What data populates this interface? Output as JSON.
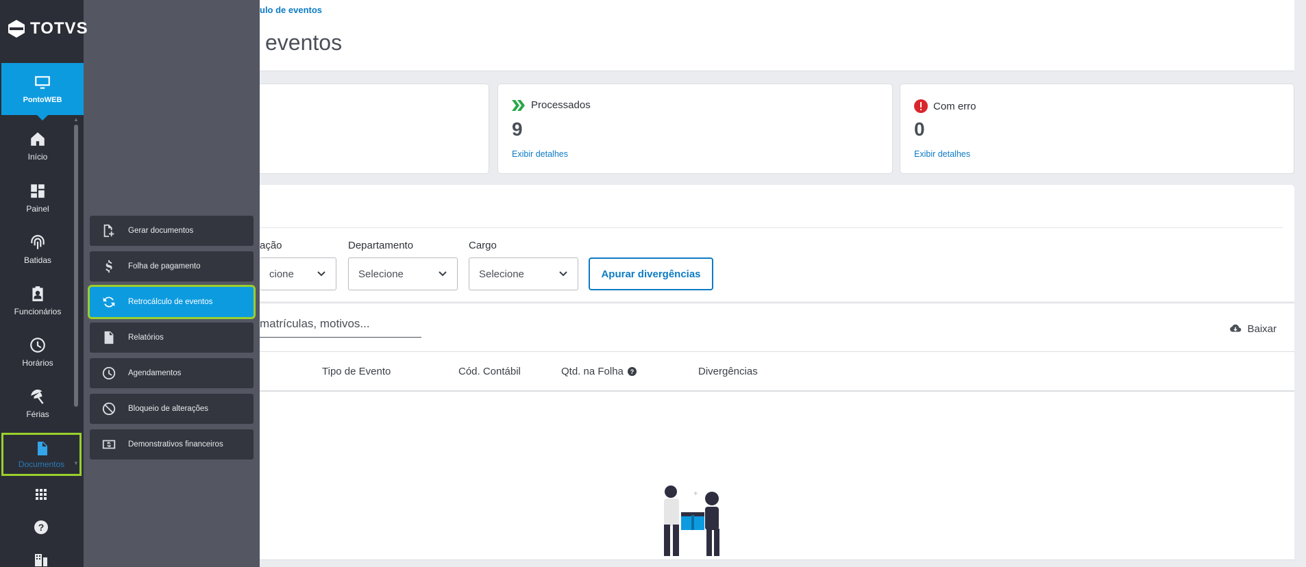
{
  "brand": {
    "name": "TOTVS"
  },
  "rail": {
    "active_app": "PontoWEB",
    "items": [
      {
        "label": "Início",
        "icon": "home-icon"
      },
      {
        "label": "Painel",
        "icon": "dashboard-icon"
      },
      {
        "label": "Batidas",
        "icon": "fingerprint-icon"
      },
      {
        "label": "Funcionários",
        "icon": "badge-icon"
      },
      {
        "label": "Horários",
        "icon": "clock-icon"
      },
      {
        "label": "Férias",
        "icon": "beach-icon"
      }
    ],
    "documents": "Documentos"
  },
  "flyout": {
    "items": [
      {
        "label": "Gerar documentos",
        "icon": "generate-doc-icon"
      },
      {
        "label": "Folha de pagamento",
        "icon": "dollar-icon"
      },
      {
        "label": "Retrocálculo de eventos",
        "icon": "sync-icon"
      },
      {
        "label": "Relatórios",
        "icon": "report-icon"
      },
      {
        "label": "Agendamentos",
        "icon": "clock-icon"
      },
      {
        "label": "Bloqueio de alterações",
        "icon": "block-icon"
      },
      {
        "label": "Demonstrativos financeiros",
        "icon": "money-icon"
      }
    ]
  },
  "header": {
    "breadcrumb": "ulo de eventos",
    "title": "eventos"
  },
  "cards": {
    "processed": {
      "label": "Processados",
      "value": "9",
      "link": "Exibir detalhes"
    },
    "error": {
      "label": "Com erro",
      "value": "0",
      "link": "Exibir detalhes"
    }
  },
  "filters": {
    "situacao_label": "ação",
    "situacao_value": "cione",
    "departamento_label": "Departamento",
    "departamento_value": "Selecione",
    "cargo_label": "Cargo",
    "cargo_value": "Selecione",
    "apply_button": "Apurar divergências"
  },
  "search": {
    "placeholder": "matrículas, motivos...",
    "download": "Baixar"
  },
  "table": {
    "columns": [
      "Tipo de Evento",
      "Cód. Contábil",
      "Qtd. na Folha",
      "Divergências"
    ]
  },
  "colors": {
    "accent": "#0d9be0",
    "highlight": "#9ad02c",
    "success": "#2aa84a",
    "error": "#d9262c",
    "link": "#0d7bc4"
  }
}
